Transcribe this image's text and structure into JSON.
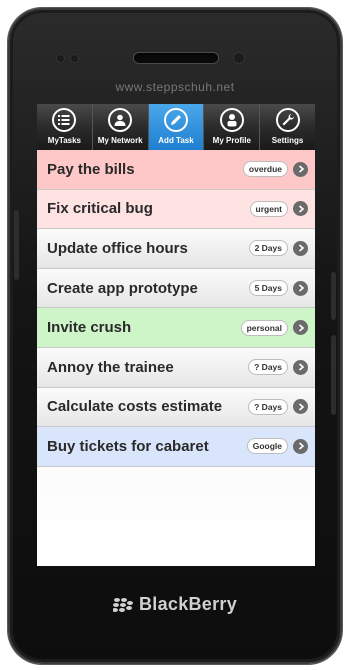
{
  "device": {
    "watermark": "www.steppschuh.net",
    "brand": "BlackBerry"
  },
  "nav": {
    "items": [
      {
        "label": "MyTasks",
        "icon": "list-icon",
        "active": false
      },
      {
        "label": "My Network",
        "icon": "person-circle-icon",
        "active": false
      },
      {
        "label": "Add Task",
        "icon": "pencil-icon",
        "active": true
      },
      {
        "label": "My Profile",
        "icon": "user-icon",
        "active": false
      },
      {
        "label": "Settings",
        "icon": "wrench-icon",
        "active": false
      }
    ]
  },
  "tasks": [
    {
      "title": "Pay the bills",
      "badge": "overdue",
      "color": "#ffc8c8"
    },
    {
      "title": "Fix critical bug",
      "badge": "urgent",
      "color": "#ffe2e2"
    },
    {
      "title": "Update office hours",
      "badge": "2 Days",
      "color": "#ececec"
    },
    {
      "title": "Create app prototype",
      "badge": "5 Days",
      "color": "#ececec"
    },
    {
      "title": "Invite crush",
      "badge": "personal",
      "color": "#cdf5c8"
    },
    {
      "title": "Annoy the trainee",
      "badge": "? Days",
      "color": "#ececec"
    },
    {
      "title": "Calculate costs estimate",
      "badge": "? Days",
      "color": "#ececec"
    },
    {
      "title": "Buy tickets for cabaret",
      "badge": "Google",
      "color": "#d9e5fb"
    }
  ],
  "colors": {
    "accent": "#2d8fdc",
    "navbar": "#2b2b2b",
    "phone_body": "#141414"
  }
}
